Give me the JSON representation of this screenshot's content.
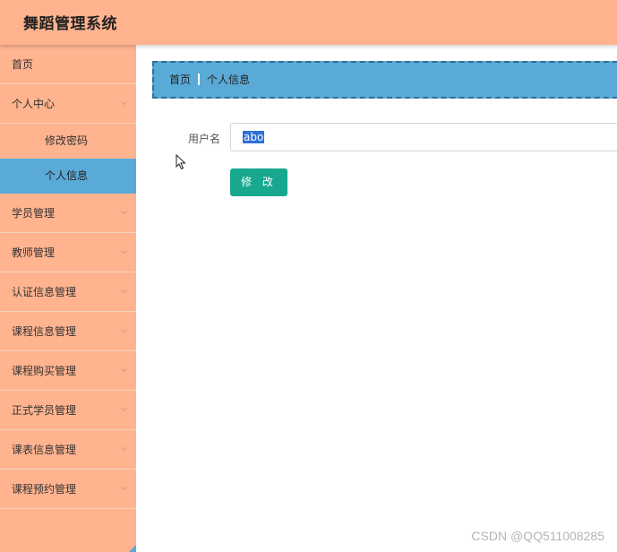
{
  "app": {
    "title": "舞蹈管理系统"
  },
  "sidebar": {
    "home": "首页",
    "personal_center": {
      "label": "个人中心",
      "children": [
        "修改密码",
        "个人信息"
      ],
      "active_child": "个人信息"
    },
    "items": [
      "学员管理",
      "教师管理",
      "认证信息管理",
      "课程信息管理",
      "课程购买管理",
      "正式学员管理",
      "课表信息管理",
      "课程预约管理"
    ],
    "icons": {
      "expand": "chevron-down-icon"
    }
  },
  "breadcrumb": {
    "home": "首页",
    "current": "个人信息"
  },
  "form": {
    "username_label": "用户名",
    "username_value": "abo",
    "submit_label": "修 改"
  },
  "watermark": "CSDN @QQ511008285",
  "colors": {
    "header_bg": "#ffb38f",
    "sidebar_bg": "#ffb38f",
    "active_bg": "#5aaad8",
    "breadcrumb_bg": "#5aaad8",
    "button_bg": "#17a88f",
    "selection_bg": "#2f6fd6"
  }
}
